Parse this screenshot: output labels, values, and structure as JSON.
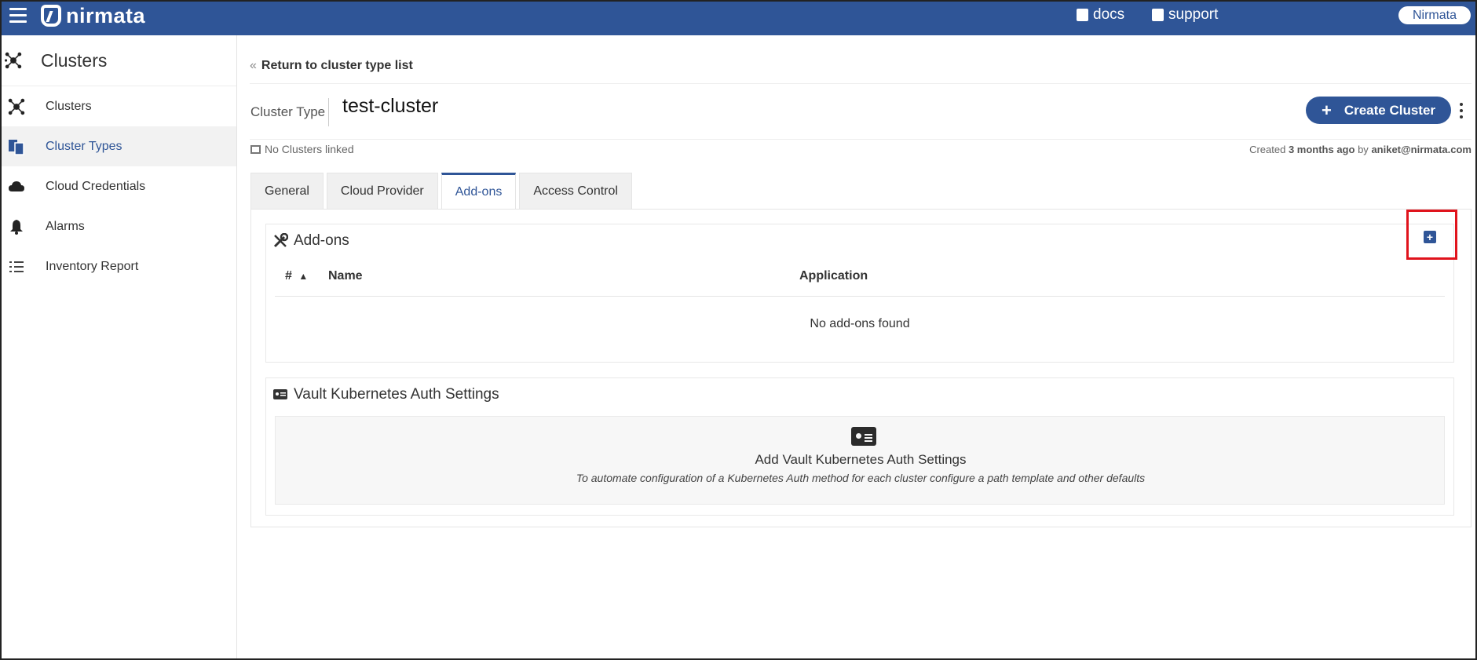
{
  "brand": {
    "name": "nirmata"
  },
  "header": {
    "docs_label": "docs",
    "support_label": "support",
    "user_name": "Nirmata"
  },
  "sidebar": {
    "title": "Clusters",
    "items": [
      {
        "label": "Clusters",
        "icon": "cluster-icon",
        "active": false
      },
      {
        "label": "Cluster Types",
        "icon": "documents-icon",
        "active": true
      },
      {
        "label": "Cloud Credentials",
        "icon": "cloud-icon",
        "active": false
      },
      {
        "label": "Alarms",
        "icon": "bell-icon",
        "active": false
      },
      {
        "label": "Inventory Report",
        "icon": "list-icon",
        "active": false
      }
    ]
  },
  "page": {
    "return_label": "Return to cluster type list",
    "cluster_type_label": "Cluster Type",
    "cluster_type_name": "test-cluster",
    "create_button_label": "Create Cluster",
    "linked_status": "No Clusters linked",
    "created_prefix": "Created",
    "created_when": "3 months ago",
    "created_by_prefix": "by",
    "created_by": "aniket@nirmata.com"
  },
  "tabs": [
    {
      "label": "General",
      "active": false
    },
    {
      "label": "Cloud Provider",
      "active": false
    },
    {
      "label": "Add-ons",
      "active": true
    },
    {
      "label": "Access Control",
      "active": false
    }
  ],
  "addons": {
    "title": "Add-ons",
    "add_button": "+",
    "columns": {
      "num": "#",
      "sort_indicator": "▲",
      "name": "Name",
      "application": "Application"
    },
    "empty_message": "No add-ons found"
  },
  "vault": {
    "title": "Vault Kubernetes Auth Settings",
    "empty_heading": "Add Vault Kubernetes Auth Settings",
    "empty_description": "To automate configuration of a Kubernetes Auth method for each cluster configure a path template and other defaults"
  },
  "colors": {
    "brand_blue": "#2f5597",
    "highlight_red": "#e0131c"
  }
}
